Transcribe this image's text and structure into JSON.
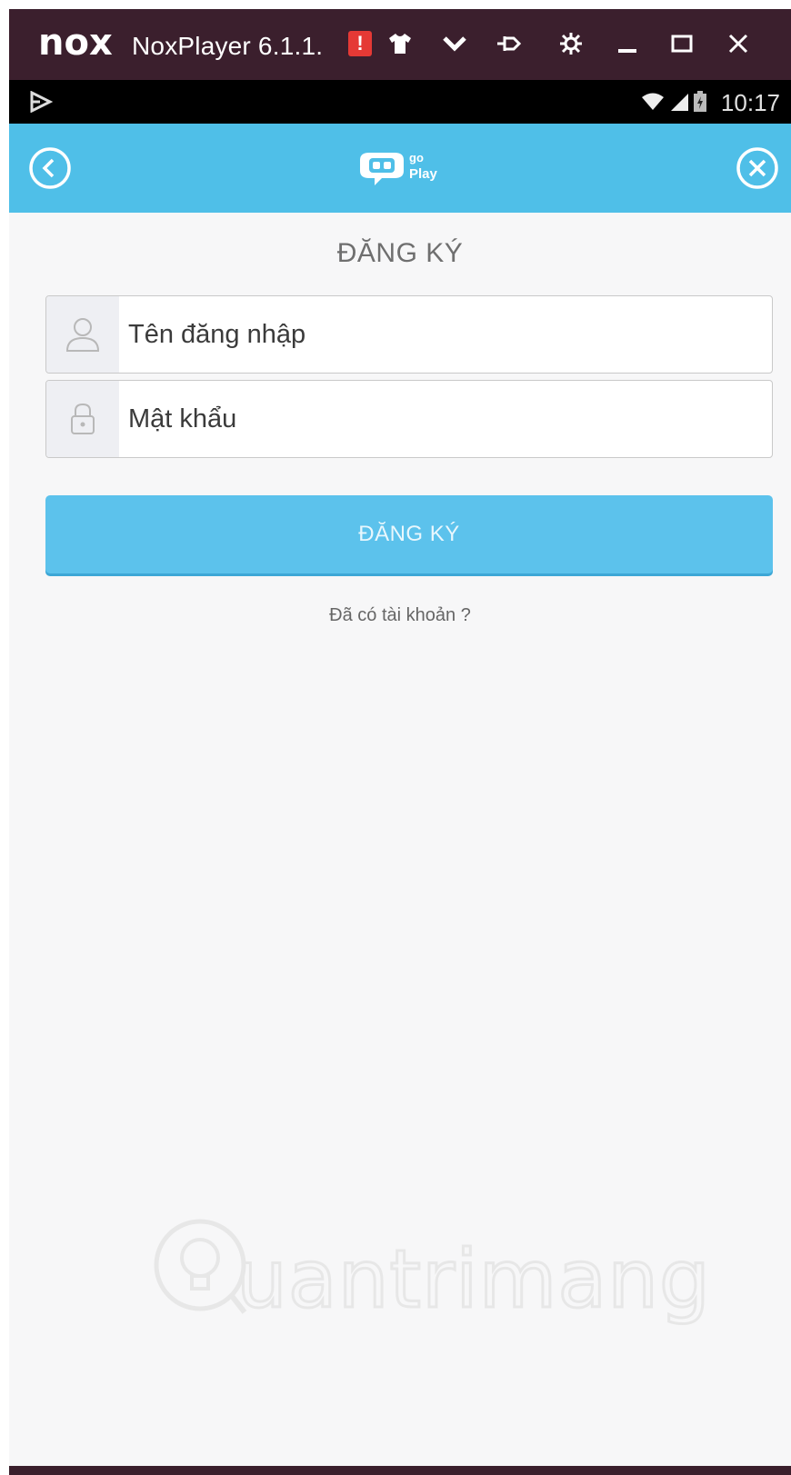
{
  "window": {
    "app_name": "NoxPlayer 6.1.1.",
    "alert_glyph": "!",
    "logo_text": "nox"
  },
  "statusbar": {
    "time": "10:17"
  },
  "header": {
    "logo_go": "go",
    "logo_play": "Play"
  },
  "form": {
    "title": "ĐĂNG KÝ",
    "username_placeholder": "Tên đăng nhập",
    "password_placeholder": "Mật khẩu",
    "submit_label": "ĐĂNG KÝ",
    "login_link": "Đã có tài khoản ?"
  },
  "watermark": {
    "text": "uantrimang"
  },
  "colors": {
    "titlebar": "#3b1f2d",
    "header": "#4fbfe8",
    "button": "#5cc2ec",
    "alert": "#e53935"
  }
}
